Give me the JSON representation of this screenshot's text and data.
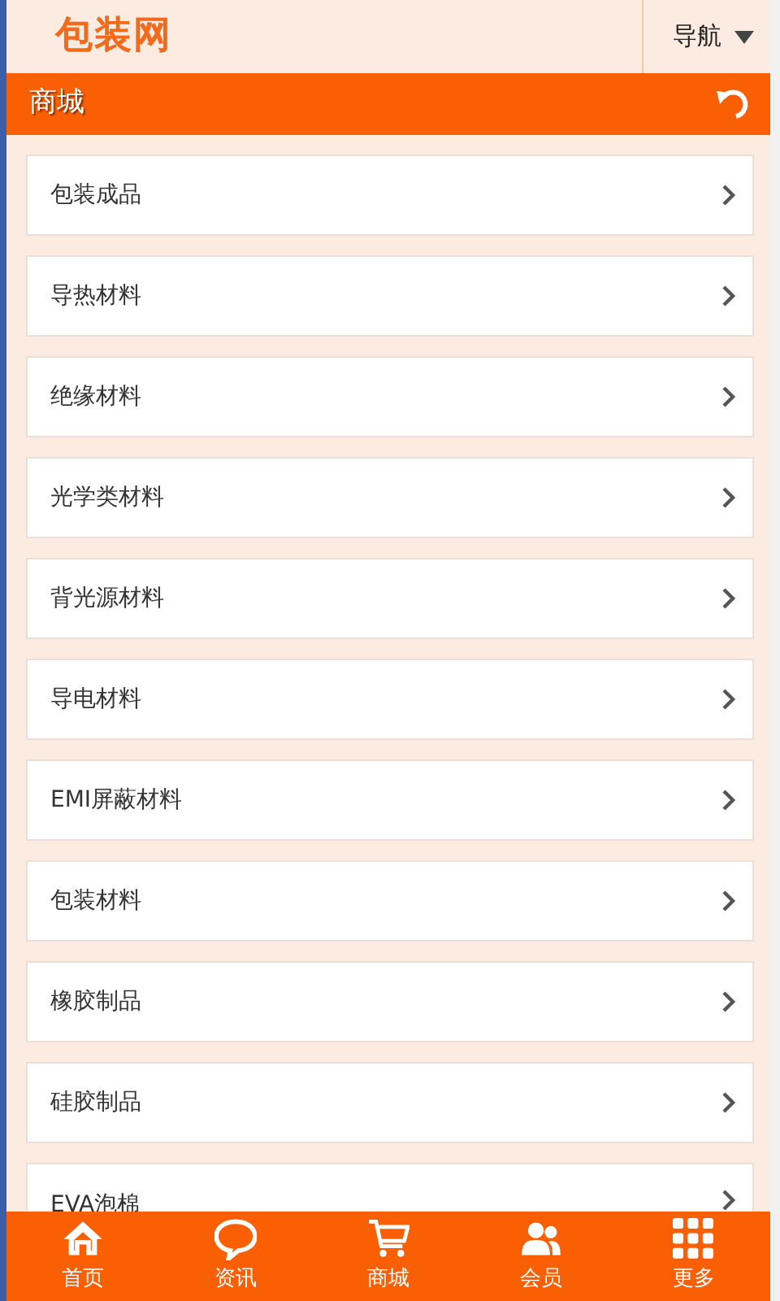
{
  "header": {
    "logo": "包装网",
    "nav_menu": "导航"
  },
  "title_bar": {
    "title": "商城"
  },
  "categories": [
    {
      "label": "包装成品"
    },
    {
      "label": "导热材料"
    },
    {
      "label": "绝缘材料"
    },
    {
      "label": "光学类材料"
    },
    {
      "label": "背光源材料"
    },
    {
      "label": "导电材料"
    },
    {
      "label": "EMI屏蔽材料"
    },
    {
      "label": "包装材料"
    },
    {
      "label": "橡胶制品"
    },
    {
      "label": "硅胶制品"
    },
    {
      "label": "EVA泡棉"
    }
  ],
  "bottom_nav": [
    {
      "kind": "home",
      "label": "首页"
    },
    {
      "kind": "chat",
      "label": "资讯"
    },
    {
      "kind": "cart",
      "label": "商城"
    },
    {
      "kind": "members",
      "label": "会员"
    },
    {
      "kind": "more",
      "label": "更多"
    }
  ]
}
